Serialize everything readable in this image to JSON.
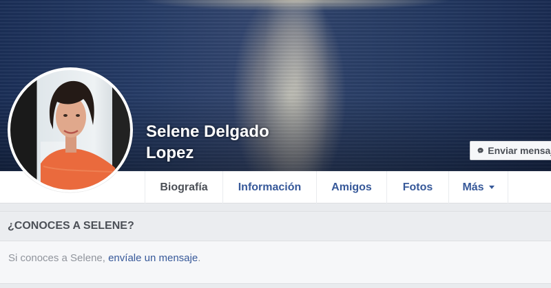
{
  "profile": {
    "name_line1": "Selene Delgado",
    "name_line2": "Lopez"
  },
  "actions": {
    "message_label": "Enviar mensaje"
  },
  "tabs": [
    {
      "label": "Biografía",
      "active": true
    },
    {
      "label": "Información",
      "active": false
    },
    {
      "label": "Amigos",
      "active": false
    },
    {
      "label": "Fotos",
      "active": false
    },
    {
      "label": "Más",
      "active": false
    }
  ],
  "know_section": {
    "title": "¿CONOCES A SELENE?",
    "text_before": "Si conoces a Selene, ",
    "link_text": "envíale un mensaje",
    "text_after": "."
  },
  "colors": {
    "link": "#365899",
    "page_bg": "#e9ebee",
    "muted_text": "#90949c",
    "dark_text": "#4b4f56"
  },
  "icons": {
    "message_button": "messenger-icon",
    "more_tab": "caret-down-icon"
  }
}
